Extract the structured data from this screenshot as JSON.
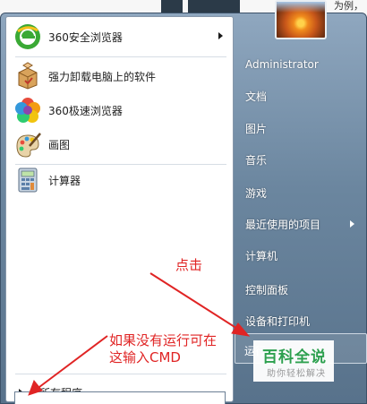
{
  "page_caption": "为例，",
  "left_programs": [
    {
      "label": "360安全浏览器",
      "icon": "360-browser-icon",
      "has_submenu": true
    },
    {
      "label": "强力卸载电脑上的软件",
      "icon": "uninstall-box-icon",
      "has_submenu": false
    },
    {
      "label": "360极速浏览器",
      "icon": "360-speed-browser-icon",
      "has_submenu": false
    },
    {
      "label": "画图",
      "icon": "paint-palette-icon",
      "has_submenu": false
    },
    {
      "label": "计算器",
      "icon": "calculator-icon",
      "has_submenu": false
    }
  ],
  "all_programs_label": "所有程序",
  "right_menu": {
    "user": "Administrator",
    "documents": "文档",
    "pictures": "图片",
    "music": "音乐",
    "games": "游戏",
    "recent_items": "最近使用的项目",
    "computer": "计算机",
    "control_panel": "控制面板",
    "devices_printers": "设备和打印机",
    "run": "运行..."
  },
  "annotations": {
    "click_hint": "点击",
    "cmd_hint_line1": "如果没有运行可在",
    "cmd_hint_line2": "这输入CMD"
  },
  "watermark": {
    "title": "百科全说",
    "subtitle": "助你轻松解决"
  },
  "colors": {
    "annotation": "#e02424",
    "watermark_green": "#2ba24c",
    "menu_blue": "#6b869f"
  }
}
